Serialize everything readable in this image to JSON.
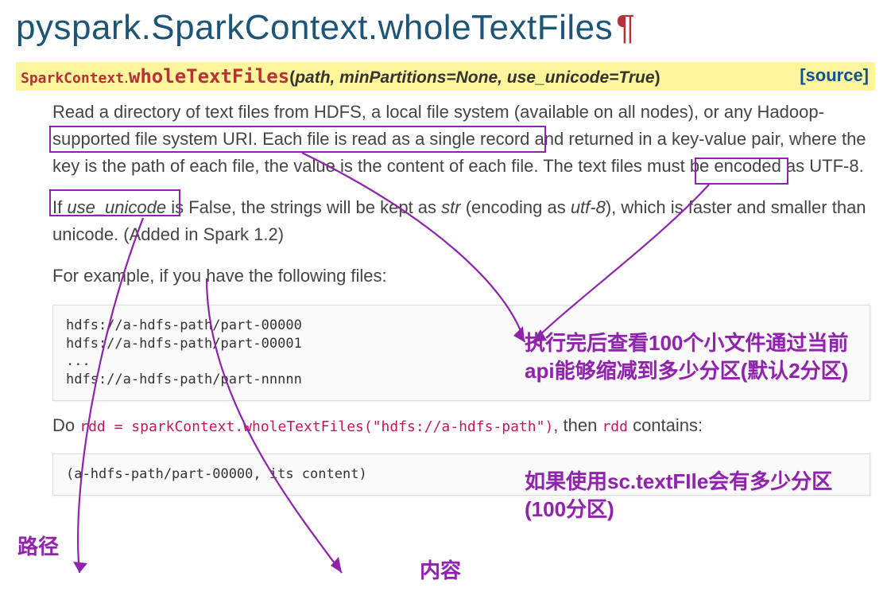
{
  "title": "pyspark.SparkContext.wholeTextFiles",
  "pilcrow": "¶",
  "signature": {
    "klass": "SparkContext",
    "dot": ".",
    "fn": "wholeTextFiles",
    "args": "path, minPartitions=None, use_unicode=True",
    "src": "[source]"
  },
  "para1_a": "Read a directory of text files from HDFS, a local file system",
  "para1_b": " (available on all nodes), or any Hadoop-supported file system URI. Each file is read as a single record and ",
  "para1_c": "returned in a key-value pair,",
  "para1_d": " where the key is the path of each file, the value is the content of each file. The text files must be encoded as UTF-8.",
  "para2_a": "If ",
  "para2_b": "use_unicode",
  "para2_c": " is False, the strings will be kept as ",
  "para2_d": "str",
  "para2_e": " (encoding as ",
  "para2_f": "utf-8",
  "para2_g": "), which is faster and smaller than unicode. (Added in Spark 1.2)",
  "para3": "For example, if you have the following files:",
  "code1": "hdfs://a-hdfs-path/part-00000\nhdfs://a-hdfs-path/part-00001\n...\nhdfs://a-hdfs-path/part-nnnnn",
  "do_a": "Do ",
  "do_b": "rdd = sparkContext.wholeTextFiles(\"hdfs://a-hdfs-path\")",
  "do_c": ", then ",
  "do_d": "rdd",
  "do_e": " contains:",
  "code2": "(a-hdfs-path/part-00000, its content)",
  "anno": {
    "r1": "执行完后查看100个小文件通过当前api能够缩减到多少分区(默认2分区)",
    "r2": "如果使用sc.textFIle会有多少分区(100分区)",
    "path": "路径",
    "content": "内容"
  }
}
